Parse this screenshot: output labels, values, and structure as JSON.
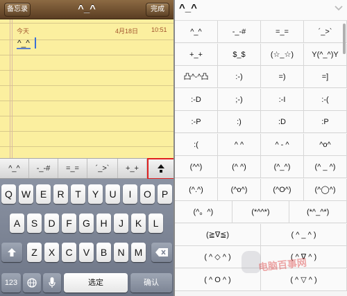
{
  "left": {
    "nav": {
      "back_label": "备忘录",
      "title": "^_^",
      "done_label": "完成"
    },
    "note": {
      "date": "今天",
      "day": "4月18日",
      "time": "10:51",
      "text": "^_^"
    },
    "suggestions": [
      "^_^",
      "-_-#",
      "=_=",
      "´_>`",
      "+_+"
    ],
    "keyboard": {
      "row1": [
        "Q",
        "W",
        "E",
        "R",
        "T",
        "Y",
        "U",
        "I",
        "O",
        "P"
      ],
      "row2": [
        "A",
        "S",
        "D",
        "F",
        "G",
        "H",
        "J",
        "K",
        "L"
      ],
      "row3": [
        "Z",
        "X",
        "C",
        "V",
        "B",
        "N",
        "M"
      ],
      "numbers_label": "123",
      "space_label": "选定",
      "confirm_label": "确认",
      "icons": {
        "shift": "shift-arrow-icon",
        "delete": "backspace-icon",
        "globe": "globe-icon",
        "mic": "microphone-icon",
        "expand": "expand-arrow-icon"
      }
    }
  },
  "right": {
    "title": "^_^",
    "rows": [
      [
        "^_^",
        "-_-#",
        "=_=",
        "´_>`"
      ],
      [
        "+_+",
        "$_$",
        "(☆_☆)",
        "Y(^_^)Y"
      ],
      [
        "凸^-^凸",
        ":-)",
        "=)",
        "=]"
      ],
      [
        ":-D",
        ";-)",
        ":-I",
        ":-("
      ],
      [
        ":-P",
        ":)",
        ":D",
        ":P"
      ],
      [
        ":(",
        "^ ^",
        "^ - ^",
        "^o^"
      ],
      [
        "(^^)",
        "(^ ^)",
        "(^_^)",
        "(^ _ ^)"
      ],
      [
        "(^.^)",
        "(^o^)",
        "(^O^)",
        "(^◯^)"
      ],
      [
        "(^。^)",
        "(*^^*)",
        "(*^_^*)"
      ],
      [
        "(≧∇≦)",
        "( ^ _ ^ )"
      ],
      [
        "( ^ ◇ ^ )",
        "( ^ ∇ ^ )"
      ],
      [
        "( ^ O ^ )",
        "( ^ ▽ ^ )"
      ]
    ],
    "watermark": "电脑百事网"
  }
}
